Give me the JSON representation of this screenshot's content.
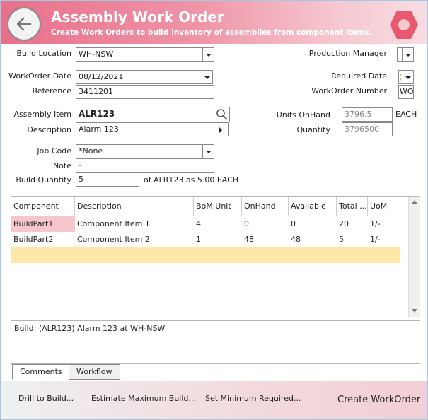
{
  "header": {
    "title": "Assembly Work Order",
    "subtitle": "Create Work Orders to build inventory of assemblies from component items."
  },
  "form": {
    "build_location": {
      "label": "Build Location",
      "value": "WH-NSW"
    },
    "production_manager": {
      "label": "Production Manager",
      "value": ""
    },
    "workorder_date": {
      "label": "WorkOrder Date",
      "value": "08/12/2021"
    },
    "required_date": {
      "label": "Required Date",
      "value": "("
    },
    "reference": {
      "label": "Reference",
      "value": "3411201"
    },
    "workorder_number": {
      "label": "WorkOrder Number",
      "value": "WO"
    },
    "assembly_item": {
      "label": "Assembly Item",
      "value": "ALR123"
    },
    "description": {
      "label": "Description",
      "value": "Alarm 123"
    },
    "units_onhand": {
      "label": "Units OnHand",
      "value": "3796.5",
      "unit": "EACH"
    },
    "quantity": {
      "label": "Quantity",
      "value": "3796500"
    },
    "job_code": {
      "label": "Job Code",
      "value": "*None"
    },
    "note": {
      "label": "Note",
      "value": "-"
    },
    "build_quantity": {
      "label": "Build Quantity",
      "value": "5",
      "suffix": "of ALR123 as 5.00 EACH"
    }
  },
  "grid": {
    "columns": [
      "Component",
      "Description",
      "BoM Unit",
      "OnHand",
      "Available",
      "Total ...",
      "UoM"
    ],
    "rows": [
      [
        "BuildPart1",
        "Component Item 1",
        "4",
        "0",
        "0",
        "20",
        "1/-"
      ],
      [
        "BuildPart2",
        "Component Item 2",
        "1",
        "48",
        "48",
        "5",
        "1/-"
      ]
    ]
  },
  "comments": {
    "text": "Build: (ALR123) Alarm 123 at WH-NSW"
  },
  "tabs": [
    "Comments",
    "Workflow"
  ],
  "footer": {
    "drill": "Drill to Build...",
    "estimate": "Estimate Maximum Build...",
    "set_min": "Set Minimum Required...",
    "create": "Create WorkOrder"
  },
  "colors": {
    "header_accent": "#e8708a",
    "highlight_cell": "#f7c6cc",
    "new_row": "#fde7a9"
  }
}
